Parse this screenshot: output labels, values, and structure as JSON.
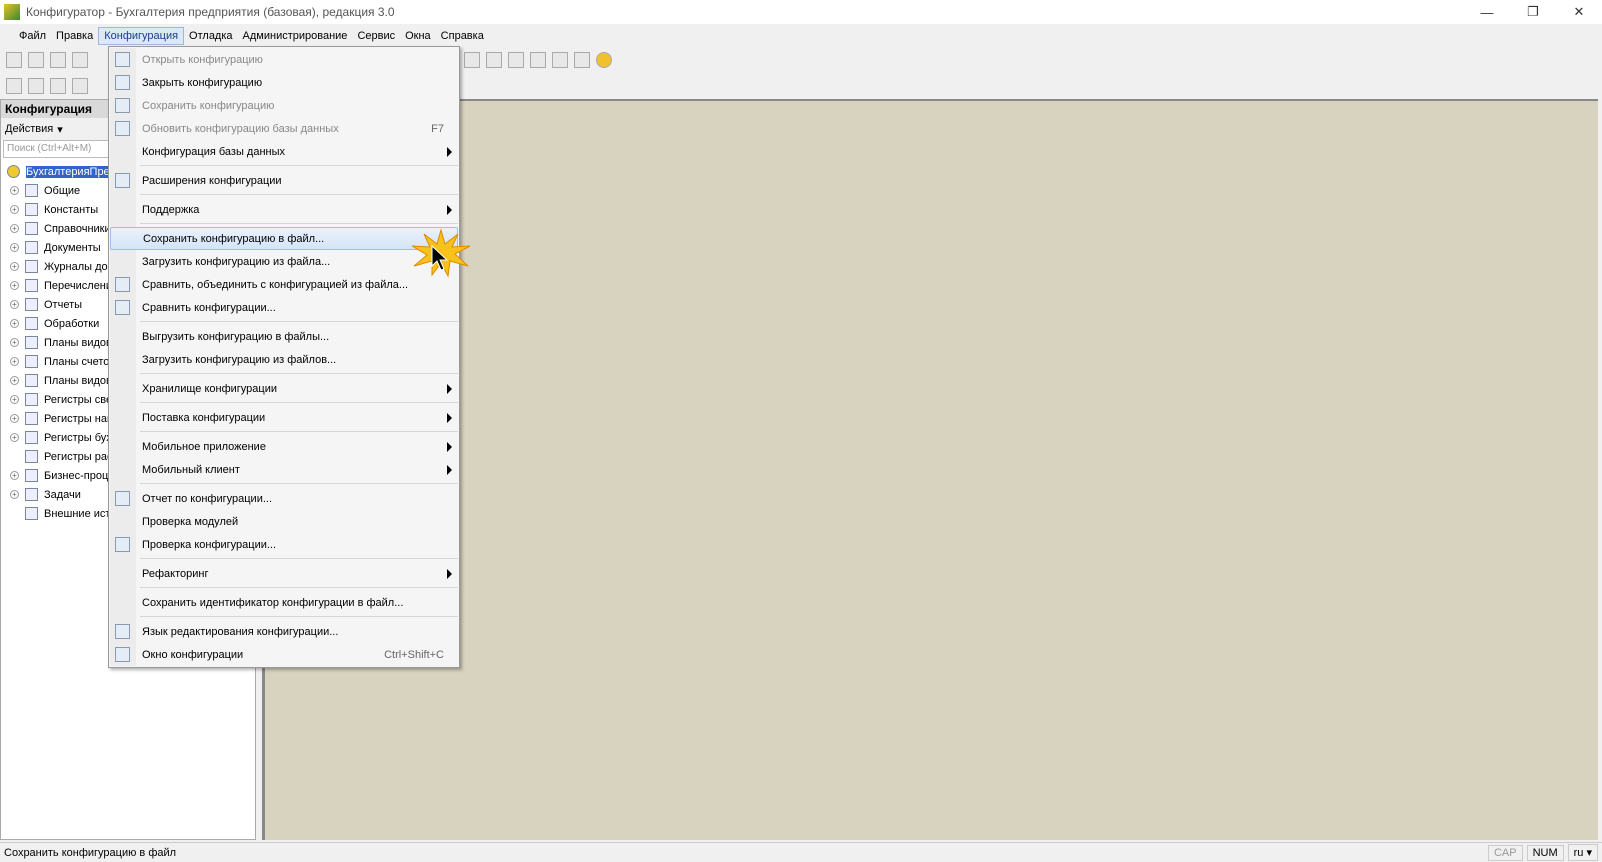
{
  "title": "Конфигуратор - Бухгалтерия предприятия (базовая), редакция 3.0",
  "menubar": [
    "Файл",
    "Правка",
    "Конфигурация",
    "Отладка",
    "Администрирование",
    "Сервис",
    "Окна",
    "Справка"
  ],
  "left_panel": {
    "title": "Конфигурация",
    "actions": "Действия",
    "search_placeholder": "Поиск (Ctrl+Alt+M)",
    "tree": [
      "БухгалтерияПредприятия",
      "Общие",
      "Константы",
      "Справочники",
      "Документы",
      "Журналы документов",
      "Перечисления",
      "Отчеты",
      "Обработки",
      "Планы видов характеристик",
      "Планы счетов",
      "Планы видов расчета",
      "Регистры сведений",
      "Регистры накопления",
      "Регистры бухгалтерии",
      "Регистры расчета",
      "Бизнес-процессы",
      "Задачи",
      "Внешние источники данных"
    ]
  },
  "menu": [
    {
      "label": "Открыть конфигурацию",
      "disabled": true
    },
    {
      "label": "Закрыть конфигурацию"
    },
    {
      "label": "Сохранить конфигурацию",
      "disabled": true
    },
    {
      "label": "Обновить конфигурацию базы данных",
      "disabled": true,
      "shortcut": "F7"
    },
    {
      "label": "Конфигурация базы данных",
      "submenu": true
    },
    {
      "sep": true
    },
    {
      "label": "Расширения конфигурации"
    },
    {
      "sep": true
    },
    {
      "label": "Поддержка",
      "submenu": true
    },
    {
      "sep": true
    },
    {
      "label": "Сохранить конфигурацию в файл...",
      "highlighted": true
    },
    {
      "label": "Загрузить конфигурацию из файла..."
    },
    {
      "label": "Сравнить, объединить с конфигурацией из файла..."
    },
    {
      "label": "Сравнить конфигурации..."
    },
    {
      "sep": true
    },
    {
      "label": "Выгрузить конфигурацию в файлы..."
    },
    {
      "label": "Загрузить конфигурацию из файлов..."
    },
    {
      "sep": true
    },
    {
      "label": "Хранилище конфигурации",
      "submenu": true
    },
    {
      "sep": true
    },
    {
      "label": "Поставка конфигурации",
      "submenu": true
    },
    {
      "sep": true
    },
    {
      "label": "Мобильное приложение",
      "submenu": true
    },
    {
      "label": "Мобильный клиент",
      "submenu": true
    },
    {
      "sep": true
    },
    {
      "label": "Отчет по конфигурации..."
    },
    {
      "label": "Проверка модулей"
    },
    {
      "label": "Проверка конфигурации..."
    },
    {
      "sep": true
    },
    {
      "label": "Рефакторинг",
      "submenu": true
    },
    {
      "sep": true
    },
    {
      "label": "Сохранить идентификатор конфигурации в файл..."
    },
    {
      "sep": true
    },
    {
      "label": "Язык редактирования конфигурации..."
    },
    {
      "label": "Окно конфигурации",
      "shortcut": "Ctrl+Shift+C"
    }
  ],
  "status": {
    "text": "Сохранить конфигурацию в файл",
    "cap": "CAP",
    "num": "NUM",
    "lang": "ru"
  }
}
